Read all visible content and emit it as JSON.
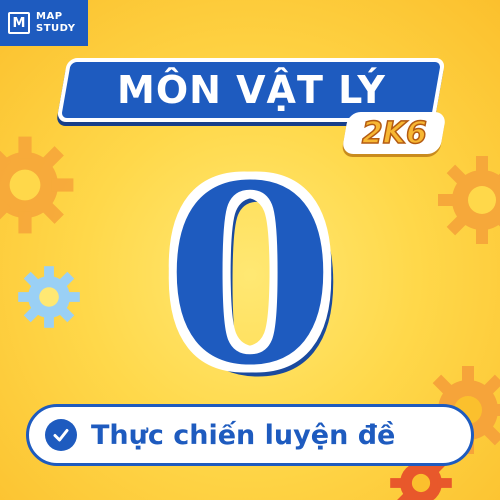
{
  "logo": {
    "mark": "M",
    "line1": "MAP",
    "line2": "STUDY"
  },
  "title": "MÔN VẬT LÝ",
  "subtitle": "2K6",
  "big_number": "0",
  "cta": {
    "label": "Thực chiến luyện đề",
    "icon": "check-circle-icon"
  },
  "colors": {
    "primary": "#1e5bbf",
    "background": "#ffd84a",
    "gear_orange": "#f6a43a",
    "gear_blue": "#9ad0f5"
  }
}
